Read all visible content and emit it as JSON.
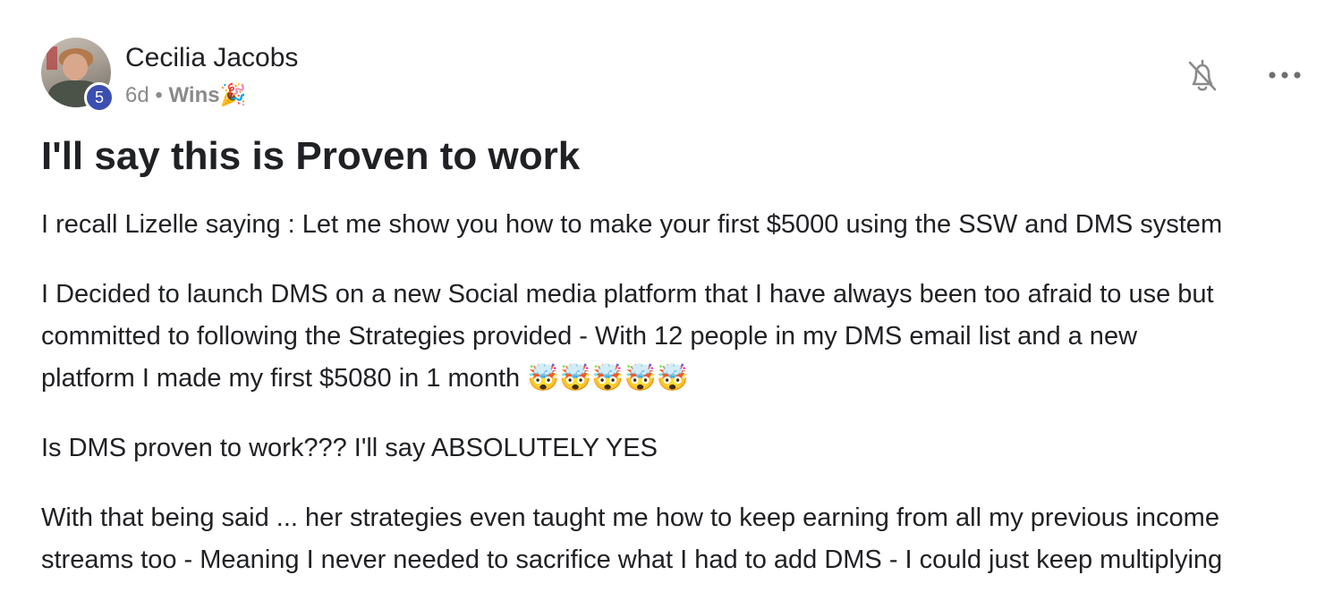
{
  "post": {
    "author": {
      "name": "Cecilia Jacobs",
      "level": "5"
    },
    "time_ago": "6d",
    "separator": "•",
    "category": "Wins🎉",
    "title": "I'll say this is Proven to work",
    "paragraphs": [
      [
        "I recall Lizelle saying : Let me show you how to make your first $5000 using the SSW and DMS system"
      ],
      [
        "I Decided to launch DMS on a new Social media platform that I have always been too afraid to use but",
        "committed to following the Strategies provided - With 12 people in my DMS email list and a new",
        "platform I made my first $5080 in 1 month 🤯🤯🤯🤯🤯"
      ],
      [
        "Is DMS proven to work??? I'll say ABSOLUTELY YES"
      ],
      [
        "With that being said ... her strategies even taught me how to keep earning from all my previous income",
        "streams too - Meaning I never needed to sacrifice what I had to add DMS - I could just keep multiplying"
      ]
    ]
  },
  "icons": {
    "bell": "bell-off-icon",
    "more": "more-horizontal-icon",
    "avatar": "author-avatar"
  },
  "colors": {
    "level_badge": "#3b4fb0",
    "text": "#202124",
    "muted": "#8a8a8a"
  }
}
